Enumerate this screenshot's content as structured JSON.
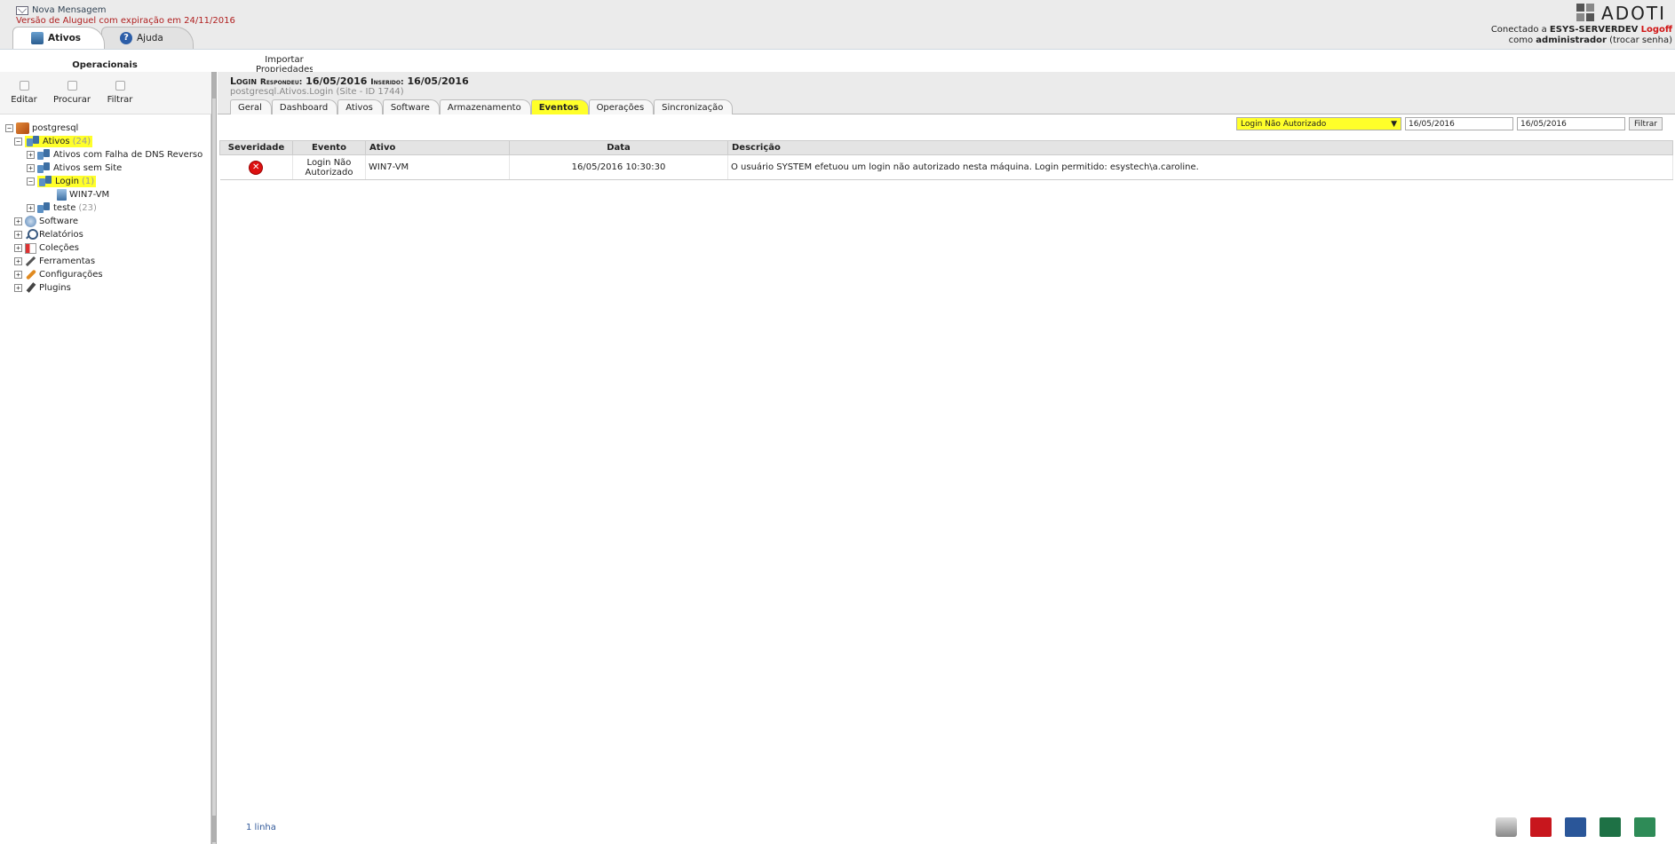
{
  "header": {
    "new_message": "Nova Mensagem",
    "rental_notice": "Versão de Aluguel com expiração em 24/11/2016",
    "top_tabs": [
      {
        "label": "Ativos"
      },
      {
        "label": "Ajuda"
      }
    ],
    "logo_text": "ADOTI",
    "connected_prefix": "Conectado a ",
    "server": "ESYS-SERVERDEV",
    "logoff": "Logoff",
    "as_prefix": "como ",
    "user": "administrador",
    "change_password": "(trocar senha)"
  },
  "subbar": {
    "sidebar_heading": "Operacionais",
    "import_properties": "Importar Propriedades"
  },
  "sidebar": {
    "toolbar": [
      {
        "label": "Editar"
      },
      {
        "label": "Procurar"
      },
      {
        "label": "Filtrar"
      }
    ],
    "tree": {
      "root": "postgresql",
      "ativos": {
        "label": "Ativos",
        "count": "(24)"
      },
      "dns": {
        "label": "Ativos com Falha de DNS Reverso"
      },
      "nosite": {
        "label": "Ativos sem Site"
      },
      "login": {
        "label": "Login",
        "count": "(1)"
      },
      "win7": {
        "label": "WIN7-VM"
      },
      "teste": {
        "label": "teste",
        "count": "(23)"
      },
      "software": {
        "label": "Software"
      },
      "relatorios": {
        "label": "Relatórios"
      },
      "colecoes": {
        "label": "Coleções"
      },
      "ferramentas": {
        "label": "Ferramentas"
      },
      "configuracoes": {
        "label": "Configurações"
      },
      "plugins": {
        "label": "Plugins"
      }
    }
  },
  "main": {
    "title": "Login",
    "responded_label": "Respondeu:",
    "responded_date": "16/05/2016",
    "inserted_label": "Inserido:",
    "inserted_date": "16/05/2016",
    "subtitle": "postgresql.Ativos.Login  (Site - ID 1744)",
    "tabs": [
      {
        "label": "Geral"
      },
      {
        "label": "Dashboard"
      },
      {
        "label": "Ativos"
      },
      {
        "label": "Software"
      },
      {
        "label": "Armazenamento"
      },
      {
        "label": "Eventos"
      },
      {
        "label": "Operações"
      },
      {
        "label": "Sincronização"
      }
    ],
    "filter": {
      "event_type": "Login Não Autorizado",
      "date_from": "16/05/2016",
      "date_to": "16/05/2016",
      "button": "Filtrar"
    },
    "table": {
      "columns": [
        "Severidade",
        "Evento",
        "Ativo",
        "Data",
        "Descrição"
      ],
      "rows": [
        {
          "severity_icon": "error-icon",
          "event": "Login Não Autorizado",
          "asset": "WIN7-VM",
          "date": "16/05/2016 10:30:30",
          "description": "O usuário SYSTEM efetuou um login não autorizado nesta máquina. Login permitido: esystech\\a.caroline."
        }
      ]
    },
    "row_count": "1 linha",
    "export_icons": [
      "printer-icon",
      "pdf-icon",
      "word-icon",
      "excel-icon",
      "csv-icon"
    ]
  },
  "colors": {
    "highlight": "#ffff2a",
    "error": "#d11111",
    "rental_notice": "#b02020",
    "logoff": "#d01515",
    "link": "#335a9a"
  }
}
